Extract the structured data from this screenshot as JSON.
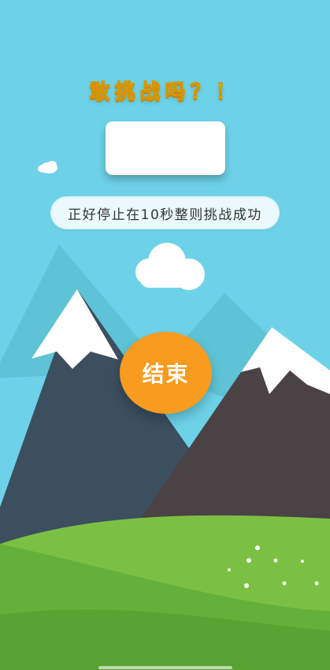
{
  "challenge": {
    "title": "敢挑战吗？！",
    "timer_value": "",
    "hint": "正好停止在10秒整则挑战成功",
    "end_button_label": "结束"
  },
  "colors": {
    "sky": "#6dd2e8",
    "title_yellow": "#ffe100",
    "button_orange": "#f99b1e",
    "grass": "#6ab63a",
    "mountain_left": "#3b4f5e",
    "mountain_right": "#4a4244"
  }
}
